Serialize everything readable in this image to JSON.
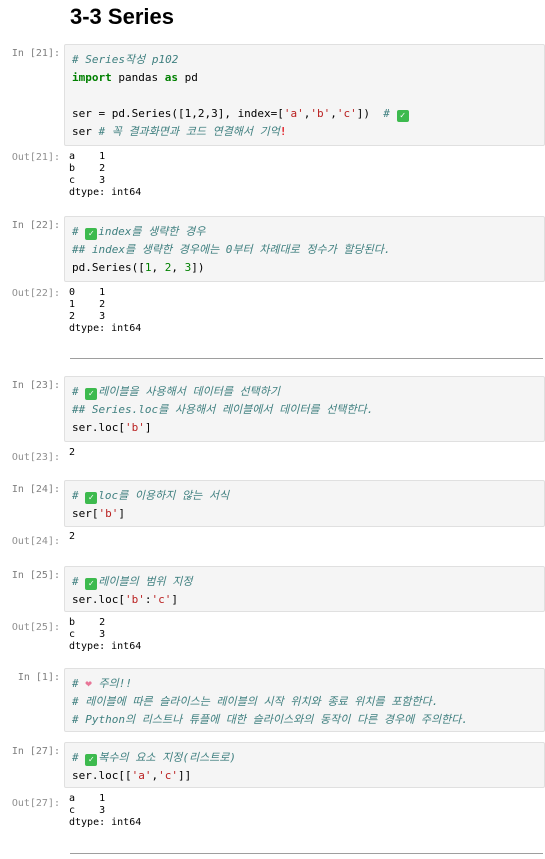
{
  "heading": "3-3 Series",
  "cells": [
    {
      "in_prompt": "In [21]:",
      "code": [
        "# Series작성 p102",
        "import pandas as pd",
        "",
        "ser = pd.Series([1,2,3], index=['a','b','c'])  #",
        "ser # 꼭 결과화면과 코드 연결해서 기억"
      ],
      "out_prompt": "Out[21]:",
      "output": [
        "a    1",
        "b    2",
        "c    3",
        "dtype: int64"
      ]
    },
    {
      "in_prompt": "In [22]:",
      "code": [
        "index를 생략한 경우",
        "## index를 생략한 경우에는 0부터 차례대로 정수가 할당된다.",
        "pd.Series([1, 2, 3])"
      ],
      "out_prompt": "Out[22]:",
      "output": [
        "0    1",
        "1    2",
        "2    3",
        "dtype: int64"
      ]
    },
    {
      "in_prompt": "In [23]:",
      "code": [
        "레이블을 사용해서 데이터를 선택하기",
        "## Series.loc를 사용해서 레이블에서 데이터를 선택한다.",
        "ser.loc['b']"
      ],
      "out_prompt": "Out[23]:",
      "output": [
        "2"
      ]
    },
    {
      "in_prompt": "In [24]:",
      "code": [
        "loc를 이용하지 않는 서식",
        "ser['b']"
      ],
      "out_prompt": "Out[24]:",
      "output": [
        "2"
      ]
    },
    {
      "in_prompt": "In [25]:",
      "code": [
        "레이블의 범위 지정",
        "ser.loc['b':'c']"
      ],
      "out_prompt": "Out[25]:",
      "output": [
        "b    2",
        "c    3",
        "dtype: int64"
      ]
    },
    {
      "in_prompt": "In [1]:",
      "code": [
        "주의!!",
        "# 레이블에 따른 슬라이스는 레이블의 시작 위치와 종료 위치를 포함한다.",
        "# Python의 리스트나 튜플에 대한 슬라이스와의 동작이 다른 경우에 주의한다."
      ]
    },
    {
      "in_prompt": "In [27]:",
      "code": [
        "복수의 요소 지정(리스트로)",
        "ser.loc[['a','c']]"
      ],
      "out_prompt": "Out[27]:",
      "output": [
        "a    1",
        "c    3",
        "dtype: int64"
      ]
    }
  ],
  "colors": {
    "comment": "#408080",
    "keyword": "#008000",
    "string": "#ba2121",
    "cell_background": "#f5f5f5",
    "prompt": "#7f7f7f",
    "check_emoji": "#3dba4e"
  },
  "icons": [
    "check-mark-icon",
    "exclamation-icon",
    "heart-icon"
  ]
}
